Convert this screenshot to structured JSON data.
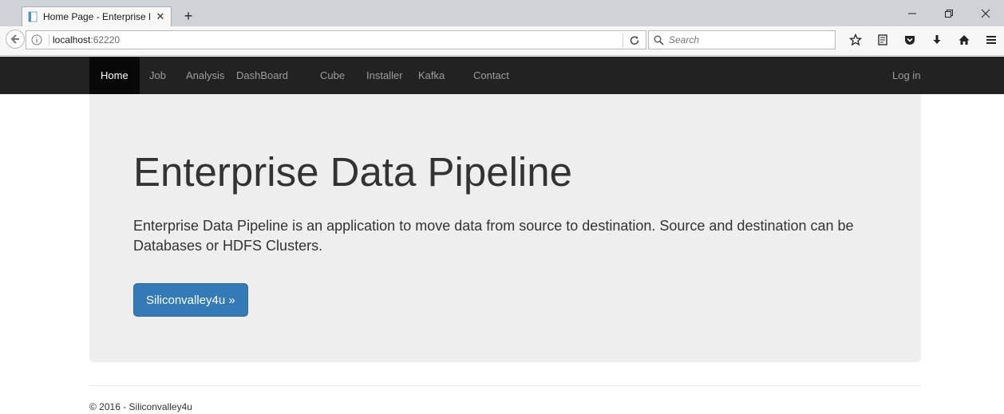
{
  "browser": {
    "tab_title": "Home Page - Enterprise D...",
    "url_host": "localhost",
    "url_port": ":62220",
    "search_placeholder": "Search"
  },
  "navbar": {
    "items": [
      {
        "label": "Home",
        "active": true
      },
      {
        "label": "Job"
      },
      {
        "label": "Analysis"
      },
      {
        "label": "DashBoard"
      },
      {
        "label": "Cube"
      },
      {
        "label": "Installer"
      },
      {
        "label": "Kafka"
      },
      {
        "label": "Contact"
      }
    ],
    "login_label": "Log in"
  },
  "jumbotron": {
    "title": "Enterprise Data Pipeline",
    "lead": "Enterprise Data Pipeline is an application to move data from source to destination. Source and destination can be Databases or HDFS Clusters.",
    "button_label": "Siliconvalley4u »"
  },
  "footer": {
    "text": "© 2016 - Siliconvalley4u"
  },
  "colors": {
    "navbar_bg": "#222222",
    "jumbotron_bg": "#eeeeee",
    "primary_button": "#337ab7"
  }
}
